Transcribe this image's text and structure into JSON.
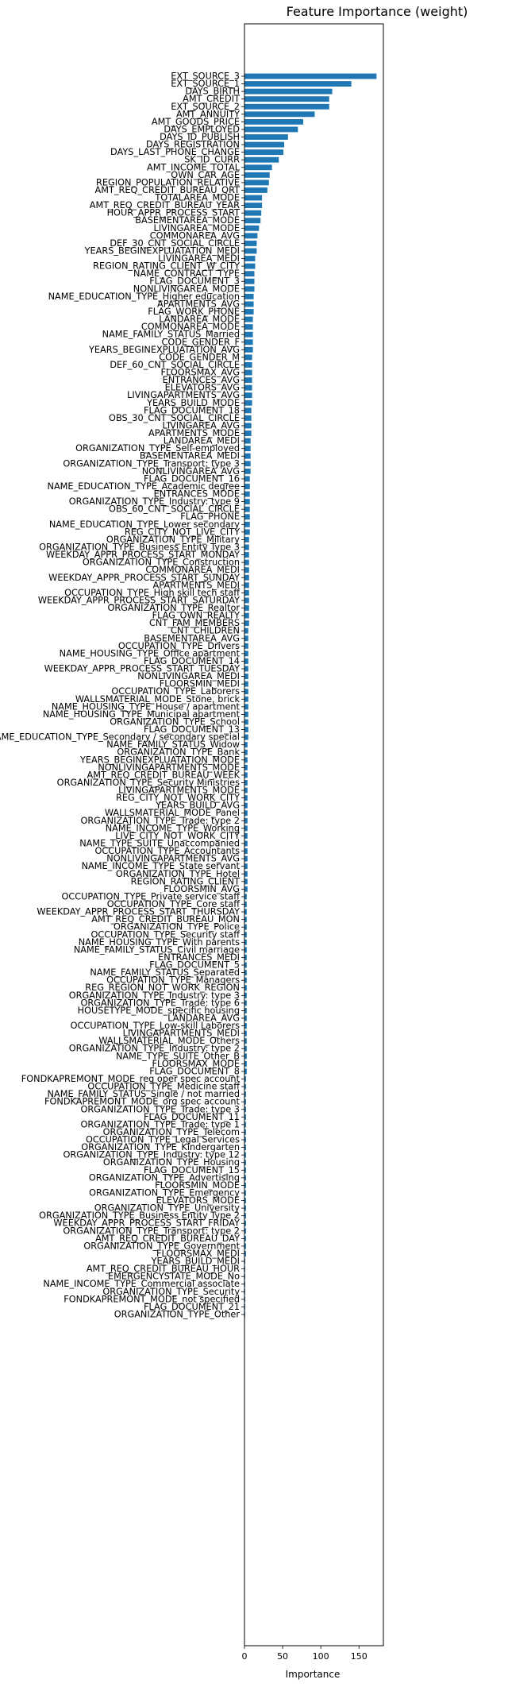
{
  "chart_data": {
    "type": "bar",
    "orientation": "horizontal",
    "title": "Feature Importance (weight)",
    "xlabel": "Importance",
    "ylabel": "",
    "xlim": [
      0,
      182
    ],
    "xticks": [
      0,
      50,
      100,
      150
    ],
    "grid": false,
    "color": "#1f77b4",
    "categories": [
      "EXT_SOURCE_3",
      "EXT_SOURCE_1",
      "DAYS_BIRTH",
      "AMT_CREDIT",
      "EXT_SOURCE_2",
      "AMT_ANNUITY",
      "AMT_GOODS_PRICE",
      "DAYS_EMPLOYED",
      "DAYS_ID_PUBLISH",
      "DAYS_REGISTRATION",
      "DAYS_LAST_PHONE_CHANGE",
      "SK_ID_CURR",
      "AMT_INCOME_TOTAL",
      "OWN_CAR_AGE",
      "REGION_POPULATION_RELATIVE",
      "AMT_REQ_CREDIT_BUREAU_QRT",
      "TOTALAREA_MODE",
      "AMT_REQ_CREDIT_BUREAU_YEAR",
      "HOUR_APPR_PROCESS_START",
      "BASEMENTAREA_MODE",
      "LIVINGAREA_MODE",
      "COMMONAREA_AVG",
      "DEF_30_CNT_SOCIAL_CIRCLE",
      "YEARS_BEGINEXPLUATATION_MEDI",
      "LIVINGAREA_MEDI",
      "REGION_RATING_CLIENT_W_CITY",
      "NAME_CONTRACT_TYPE",
      "FLAG_DOCUMENT_3",
      "NONLIVINGAREA_MODE",
      "NAME_EDUCATION_TYPE_Higher education",
      "APARTMENTS_AVG",
      "FLAG_WORK_PHONE",
      "LANDAREA_MODE",
      "COMMONAREA_MODE",
      "NAME_FAMILY_STATUS_Married",
      "CODE_GENDER_F",
      "YEARS_BEGINEXPLUATATION_AVG",
      "CODE_GENDER_M",
      "DEF_60_CNT_SOCIAL_CIRCLE",
      "FLOORSMAX_AVG",
      "ENTRANCES_AVG",
      "ELEVATORS_AVG",
      "LIVINGAPARTMENTS_AVG",
      "YEARS_BUILD_MODE",
      "FLAG_DOCUMENT_18",
      "OBS_30_CNT_SOCIAL_CIRCLE",
      "LIVINGAREA_AVG",
      "APARTMENTS_MODE",
      "LANDAREA_MEDI",
      "ORGANIZATION_TYPE_Self-employed",
      "BASEMENTAREA_MEDI",
      "ORGANIZATION_TYPE_Transport: type 3",
      "NONLIVINGAREA_AVG",
      "FLAG_DOCUMENT_16",
      "NAME_EDUCATION_TYPE_Academic degree",
      "ENTRANCES_MODE",
      "ORGANIZATION_TYPE_Industry: type 9",
      "OBS_60_CNT_SOCIAL_CIRCLE",
      "FLAG_PHONE",
      "NAME_EDUCATION_TYPE_Lower secondary",
      "REG_CITY_NOT_LIVE_CITY",
      "ORGANIZATION_TYPE_Military",
      "ORGANIZATION_TYPE_Business Entity Type 3",
      "WEEKDAY_APPR_PROCESS_START_MONDAY",
      "ORGANIZATION_TYPE_Construction",
      "COMMONAREA_MEDI",
      "WEEKDAY_APPR_PROCESS_START_SUNDAY",
      "APARTMENTS_MEDI",
      "OCCUPATION_TYPE_High skill tech staff",
      "WEEKDAY_APPR_PROCESS_START_SATURDAY",
      "ORGANIZATION_TYPE_Realtor",
      "FLAG_OWN_REALTY",
      "CNT_FAM_MEMBERS",
      "CNT_CHILDREN",
      "BASEMENTAREA_AVG",
      "OCCUPATION_TYPE_Drivers",
      "NAME_HOUSING_TYPE_Office apartment",
      "FLAG_DOCUMENT_14",
      "WEEKDAY_APPR_PROCESS_START_TUESDAY",
      "NONLIVINGAREA_MEDI",
      "FLOORSMIN_MEDI",
      "OCCUPATION_TYPE_Laborers",
      "WALLSMATERIAL_MODE_Stone, brick",
      "NAME_HOUSING_TYPE_House / apartment",
      "NAME_HOUSING_TYPE_Municipal apartment",
      "ORGANIZATION_TYPE_School",
      "FLAG_DOCUMENT_13",
      "NAME_EDUCATION_TYPE_Secondary / secondary special",
      "NAME_FAMILY_STATUS_Widow",
      "ORGANIZATION_TYPE_Bank",
      "YEARS_BEGINEXPLUATATION_MODE",
      "NONLIVINGAPARTMENTS_MODE",
      "AMT_REQ_CREDIT_BUREAU_WEEK",
      "ORGANIZATION_TYPE_Security Ministries",
      "LIVINGAPARTMENTS_MODE",
      "REG_CITY_NOT_WORK_CITY",
      "YEARS_BUILD_AVG",
      "WALLSMATERIAL_MODE_Panel",
      "ORGANIZATION_TYPE_Trade: type 2",
      "NAME_INCOME_TYPE_Working",
      "LIVE_CITY_NOT_WORK_CITY",
      "NAME_TYPE_SUITE_Unaccompanied",
      "OCCUPATION_TYPE_Accountants",
      "NONLIVINGAPARTMENTS_AVG",
      "NAME_INCOME_TYPE_State servant",
      "ORGANIZATION_TYPE_Hotel",
      "REGION_RATING_CLIENT",
      "FLOORSMIN_AVG",
      "OCCUPATION_TYPE_Private service staff",
      "OCCUPATION_TYPE_Core staff",
      "WEEKDAY_APPR_PROCESS_START_THURSDAY",
      "AMT_REQ_CREDIT_BUREAU_MON",
      "ORGANIZATION_TYPE_Police",
      "OCCUPATION_TYPE_Security staff",
      "NAME_HOUSING_TYPE_With parents",
      "NAME_FAMILY_STATUS_Civil marriage",
      "ENTRANCES_MEDI",
      "FLAG_DOCUMENT_5",
      "NAME_FAMILY_STATUS_Separated",
      "OCCUPATION_TYPE_Managers",
      "REG_REGION_NOT_WORK_REGION",
      "ORGANIZATION_TYPE_Industry: type 3",
      "ORGANIZATION_TYPE_Trade: type 6",
      "HOUSETYPE_MODE_specific housing",
      "LANDAREA_AVG",
      "OCCUPATION_TYPE_Low-skill Laborers",
      "LIVINGAPARTMENTS_MEDI",
      "WALLSMATERIAL_MODE_Others",
      "ORGANIZATION_TYPE_Industry: type 2",
      "NAME_TYPE_SUITE_Other_B",
      "FLOORSMAX_MODE",
      "FLAG_DOCUMENT_8",
      "FONDKAPREMONT_MODE_reg oper spec account",
      "OCCUPATION_TYPE_Medicine staff",
      "NAME_FAMILY_STATUS_Single / not married",
      "FONDKAPREMONT_MODE_org spec account",
      "ORGANIZATION_TYPE_Trade: type 3",
      "FLAG_DOCUMENT_11",
      "ORGANIZATION_TYPE_Trade: type 1",
      "ORGANIZATION_TYPE_Telecom",
      "OCCUPATION_TYPE_Legal Services",
      "ORGANIZATION_TYPE_Kindergarten",
      "ORGANIZATION_TYPE_Industry: type 12",
      "ORGANIZATION_TYPE_Housing",
      "FLAG_DOCUMENT_15",
      "ORGANIZATION_TYPE_Advertising",
      "FLOORSMIN_MODE",
      "ORGANIZATION_TYPE_Emergency",
      "ELEVATORS_MODE",
      "ORGANIZATION_TYPE_University",
      "ORGANIZATION_TYPE_Business Entity Type 2",
      "WEEKDAY_APPR_PROCESS_START_FRIDAY",
      "ORGANIZATION_TYPE_Transport: type 2",
      "AMT_REQ_CREDIT_BUREAU_DAY",
      "ORGANIZATION_TYPE_Government",
      "FLOORSMAX_MEDI",
      "YEARS_BUILD_MEDI",
      "AMT_REQ_CREDIT_BUREAU_HOUR",
      "EMERGENCYSTATE_MODE_No",
      "NAME_INCOME_TYPE_Commercial associate",
      "ORGANIZATION_TYPE_Security",
      "FONDKAPREMONT_MODE_not specified",
      "FLAG_DOCUMENT_21",
      "ORGANIZATION_TYPE_Other"
    ],
    "values": [
      173,
      140,
      115,
      111,
      111,
      92,
      77,
      70,
      57,
      52,
      51,
      45,
      36,
      33,
      32,
      30,
      23,
      23,
      22,
      21,
      19,
      17,
      16,
      16,
      14,
      14,
      13,
      13,
      13,
      12,
      12,
      12,
      11,
      11,
      11,
      11,
      11,
      10,
      10,
      10,
      10,
      10,
      10,
      10,
      9,
      9,
      9,
      9,
      8,
      8,
      8,
      8,
      8,
      7,
      7,
      7,
      7,
      7,
      7,
      7,
      7,
      6,
      6,
      6,
      6,
      6,
      6,
      6,
      6,
      6,
      6,
      6,
      6,
      5,
      5,
      5,
      5,
      5,
      5,
      5,
      5,
      5,
      5,
      5,
      5,
      5,
      5,
      5,
      4,
      4,
      4,
      4,
      4,
      4,
      4,
      4,
      4,
      4,
      4,
      4,
      4,
      4,
      4,
      4,
      4,
      4,
      4,
      4,
      3,
      3,
      3,
      3,
      3,
      3,
      3,
      3,
      3,
      3,
      3,
      3,
      3,
      3,
      3,
      3,
      3,
      3,
      3,
      3,
      3,
      3,
      3,
      3,
      2,
      2,
      2,
      2,
      2,
      2,
      2,
      2,
      2,
      2,
      2,
      2,
      2,
      2,
      2,
      2,
      2,
      2,
      2,
      2,
      2,
      2,
      2,
      2,
      1,
      1,
      1,
      1,
      1,
      1,
      1,
      1
    ]
  }
}
